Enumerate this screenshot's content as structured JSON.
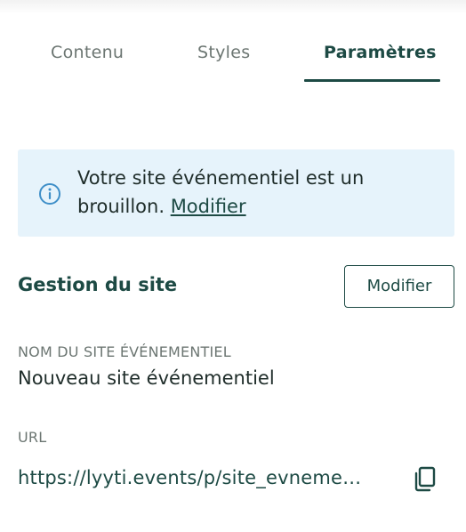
{
  "tabs": {
    "contenu": "Contenu",
    "styles": "Styles",
    "parametres": "Paramètres",
    "active": "parametres"
  },
  "notice": {
    "icon": "info-icon",
    "text": "Votre site événementiel est un brouillon.",
    "link_label": "Modifier"
  },
  "site_management": {
    "title": "Gestion du site",
    "modify_label": "Modifier"
  },
  "site_name": {
    "label": "NOM DU SITE ÉVÉNEMENTIEL",
    "value": "Nouveau site événementiel"
  },
  "url": {
    "label": "URL",
    "value": "https://lyyti.events/p/site_evnementiel",
    "copy_icon": "copy-icon"
  },
  "colors": {
    "accent": "#1d4a44",
    "notice_bg": "#e6f3fb",
    "info_icon": "#3f8fc8",
    "muted_text": "#6c7672"
  }
}
